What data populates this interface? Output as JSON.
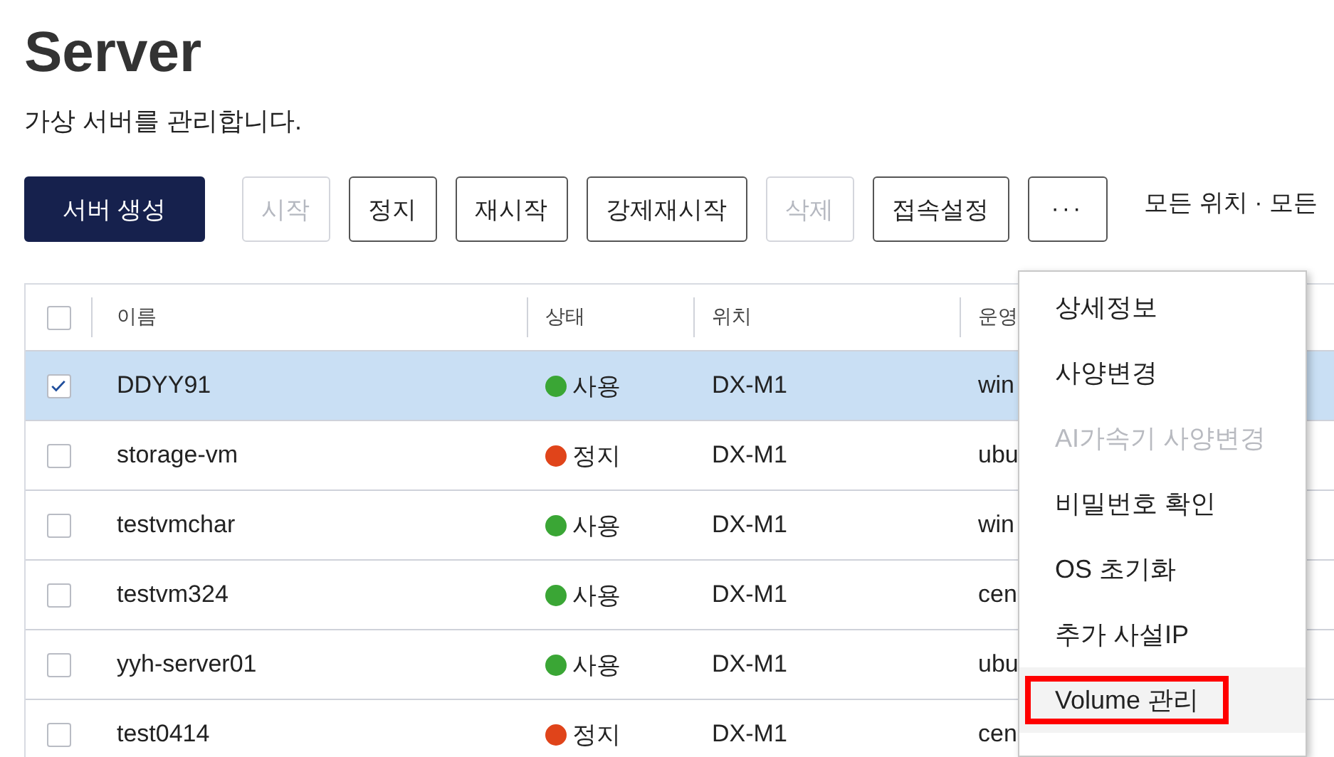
{
  "page": {
    "title": "Server",
    "subtitle": "가상 서버를 관리합니다."
  },
  "toolbar": {
    "buttons": [
      {
        "label": "서버 생성",
        "kind": "primary",
        "disabled": false
      },
      {
        "label": "시작",
        "kind": "outline",
        "disabled": true
      },
      {
        "label": "정지",
        "kind": "outline",
        "disabled": false
      },
      {
        "label": "재시작",
        "kind": "outline",
        "disabled": false
      },
      {
        "label": "강제재시작",
        "kind": "outline",
        "disabled": false
      },
      {
        "label": "삭제",
        "kind": "outline",
        "disabled": true
      },
      {
        "label": "접속설정",
        "kind": "outline",
        "disabled": false
      },
      {
        "label": "···",
        "kind": "more",
        "disabled": false
      }
    ],
    "filter": "모든 위치 · 모든"
  },
  "table": {
    "header_checked": false,
    "columns": [
      "이름",
      "상태",
      "위치",
      "운영"
    ],
    "rows": [
      {
        "name": "DDYY91",
        "status": "사용",
        "color": "#3aa635",
        "location": "DX-M1",
        "os": "win",
        "selected": true
      },
      {
        "name": "storage-vm",
        "status": "정지",
        "color": "#e0441a",
        "location": "DX-M1",
        "os": "ubu",
        "selected": false
      },
      {
        "name": "testvmchar",
        "status": "사용",
        "color": "#3aa635",
        "location": "DX-M1",
        "os": "win",
        "selected": false
      },
      {
        "name": "testvm324",
        "status": "사용",
        "color": "#3aa635",
        "location": "DX-M1",
        "os": "cen",
        "selected": false
      },
      {
        "name": "yyh-server01",
        "status": "사용",
        "color": "#3aa635",
        "location": "DX-M1",
        "os": "ubu",
        "selected": false
      },
      {
        "name": "test0414",
        "status": "정지",
        "color": "#e0441a",
        "location": "DX-M1",
        "os": "cen",
        "selected": false
      }
    ]
  },
  "menu": {
    "items": [
      {
        "label": "상세정보",
        "disabled": false,
        "hovered": false,
        "outlined": false
      },
      {
        "label": "사양변경",
        "disabled": false,
        "hovered": false,
        "outlined": false
      },
      {
        "label": "AI가속기 사양변경",
        "disabled": true,
        "hovered": false,
        "outlined": false
      },
      {
        "label": "비밀번호 확인",
        "disabled": false,
        "hovered": false,
        "outlined": false
      },
      {
        "label": "OS 초기화",
        "disabled": false,
        "hovered": false,
        "outlined": false
      },
      {
        "label": "추가 사설IP",
        "disabled": false,
        "hovered": false,
        "outlined": false
      },
      {
        "label": "Volume 관리",
        "disabled": false,
        "hovered": true,
        "outlined": true
      }
    ]
  }
}
